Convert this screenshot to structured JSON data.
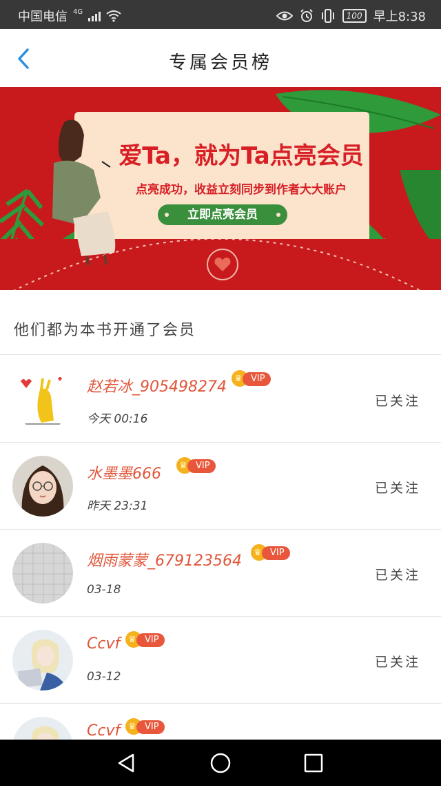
{
  "status_bar": {
    "carrier": "中国电信",
    "network": "4G",
    "battery": "100",
    "time": "早上8:38"
  },
  "header": {
    "title": "专属会员榜",
    "back_icon": "chevron-left-icon"
  },
  "banner": {
    "headline": "爱Ta，就为Ta点亮会员",
    "subtext": "点亮成功，收益立刻同步到作者大大账户",
    "button_label": "立即点亮会员"
  },
  "section": {
    "title": "他们都为本书开通了会员"
  },
  "members": [
    {
      "name": "赵若冰_905498274",
      "badge": "VIP",
      "time": "今天 00:16",
      "follow_label": "已关注"
    },
    {
      "name": "水墨墨666",
      "badge": "VIP",
      "time": "昨天 23:31",
      "follow_label": "已关注"
    },
    {
      "name": "烟雨蒙蒙_679123564",
      "badge": "VIP",
      "time": "03-18",
      "follow_label": "已关注"
    },
    {
      "name": "Ccvf",
      "badge": "VIP",
      "time": "03-12",
      "follow_label": "已关注"
    },
    {
      "name": "Ccvf",
      "badge": "VIP",
      "time": "",
      "follow_label": ""
    }
  ],
  "colors": {
    "banner_red": "#c8191c",
    "name_red": "#e0563a",
    "vip_orange": "#e8573b",
    "crown_gold": "#f6b11e",
    "button_green": "#3a8f3d",
    "back_blue": "#2b8fe0"
  }
}
